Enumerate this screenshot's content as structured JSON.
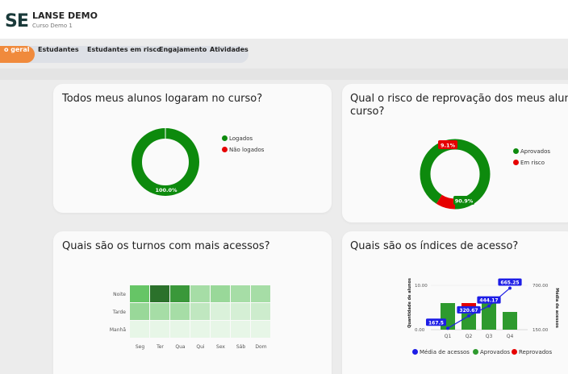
{
  "header": {
    "logo": "SE",
    "title": "LANSE DEMO",
    "subtitle": "Curso Demo 1"
  },
  "tabs": [
    {
      "label": "o geral",
      "active": true
    },
    {
      "label": "Estudantes",
      "active": false
    },
    {
      "label": "Estudantes em risco",
      "active": false
    },
    {
      "label": "Engajamento",
      "active": false
    },
    {
      "label": "Atividades",
      "active": false
    }
  ],
  "colors": {
    "accent": "#f08a3c",
    "green": "#0d8a0d",
    "red": "#e60000",
    "blue": "#1d1de6"
  },
  "cards": {
    "login": {
      "title": "Todos meus alunos logaram no curso?",
      "legend": [
        "Logados",
        "Não logados"
      ],
      "chart_data": {
        "type": "pie",
        "labels": [
          "Logados",
          "Não logados"
        ],
        "values": [
          100.0,
          0.0
        ],
        "label_text": "100.0%"
      }
    },
    "risk": {
      "title_line1": "Qual o risco de reprovação dos meus alunos",
      "title_line2": "curso?",
      "legend": [
        "Aprovados",
        "Em risco"
      ],
      "chart_data": {
        "type": "pie",
        "labels": [
          "Aprovados",
          "Em risco"
        ],
        "values": [
          90.9,
          9.1
        ],
        "label_texts": [
          "90.9%",
          "9.1%"
        ]
      }
    },
    "shifts": {
      "title": "Quais são os turnos com mais acessos?",
      "chart_data": {
        "type": "heatmap",
        "rows": [
          "Noite",
          "Tarde",
          "Manhã"
        ],
        "columns": [
          "Seg",
          "Ter",
          "Qua",
          "Qui",
          "Sex",
          "Sáb",
          "Dom"
        ],
        "values": [
          [
            0.55,
            0.95,
            0.8,
            0.3,
            0.35,
            0.3,
            0.3
          ],
          [
            0.35,
            0.3,
            0.3,
            0.2,
            0.1,
            0.12,
            0.15
          ],
          [
            0.05,
            0.05,
            0.05,
            0.05,
            0.05,
            0.05,
            0.05
          ]
        ]
      }
    },
    "access": {
      "title": "Quais são os índices de acesso?",
      "legend": [
        "Média de acessos",
        "Aprovados",
        "Reprovados"
      ],
      "chart_data": {
        "type": "bar",
        "categories": [
          "Q1",
          "Q2",
          "Q3",
          "Q4"
        ],
        "series": [
          {
            "name": "Aprovados",
            "values": [
              6,
              5,
              6,
              4
            ]
          },
          {
            "name": "Reprovados",
            "values": [
              0,
              1,
              0,
              0
            ]
          },
          {
            "name": "Média de acessos",
            "values": [
              167.5,
              320.67,
              444.17,
              665.25
            ]
          }
        ],
        "point_labels": [
          "167.5",
          "320.67",
          "444.17",
          "665.25"
        ],
        "ylabel_left": "Quantidade de alunos",
        "ylabel_right": "Média de acessos",
        "left_ticks": [
          "10.00",
          "0.00"
        ],
        "right_ticks": [
          "700.00",
          "150.00"
        ],
        "ylim_left": [
          0,
          10
        ],
        "ylim_right": [
          150,
          700
        ]
      }
    }
  }
}
